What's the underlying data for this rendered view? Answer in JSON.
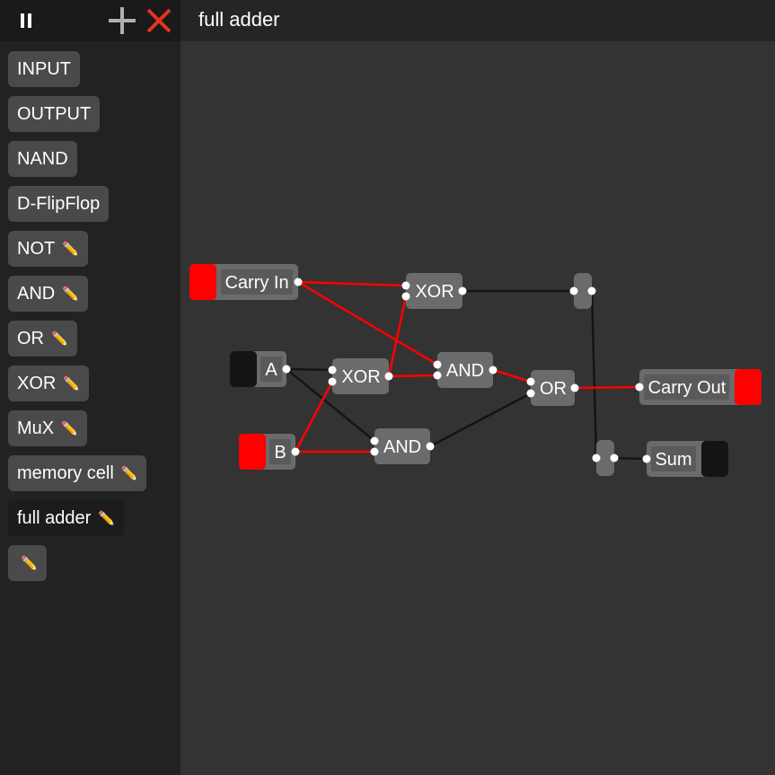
{
  "toolbar": {
    "pause_icon": "pause-icon",
    "add_icon": "plus-icon",
    "close_icon": "close-icon",
    "add_color": "#b0b0b0",
    "close_color": "#e8321e"
  },
  "header": {
    "title": "full adder"
  },
  "sidebar": {
    "items": [
      {
        "label": "INPUT",
        "editable": false
      },
      {
        "label": "OUTPUT",
        "editable": false
      },
      {
        "label": "NAND",
        "editable": false
      },
      {
        "label": "D-FlipFlop",
        "editable": false
      },
      {
        "label": "NOT",
        "editable": true
      },
      {
        "label": "AND",
        "editable": true
      },
      {
        "label": "OR",
        "editable": true
      },
      {
        "label": "XOR",
        "editable": true
      },
      {
        "label": "MuX",
        "editable": true
      },
      {
        "label": "memory cell",
        "editable": true
      },
      {
        "label": "full adder",
        "editable": true,
        "active": true
      },
      {
        "label": "",
        "editable": true
      }
    ],
    "edit_icon": "pencil-icon"
  },
  "circuit": {
    "colors": {
      "active": "#ff0000",
      "inactive": "#141414",
      "gate": "#6b6b6b",
      "gate_inner": "#5a5a5a"
    },
    "inputs": [
      {
        "label": "Carry In",
        "state": "on"
      },
      {
        "label": "A",
        "state": "off"
      },
      {
        "label": "B",
        "state": "on"
      }
    ],
    "outputs": [
      {
        "label": "Carry Out",
        "state": "on"
      },
      {
        "label": "Sum",
        "state": "off"
      }
    ],
    "gates": [
      {
        "label": "XOR"
      },
      {
        "label": "XOR"
      },
      {
        "label": "AND"
      },
      {
        "label": "AND"
      },
      {
        "label": "OR"
      }
    ]
  }
}
